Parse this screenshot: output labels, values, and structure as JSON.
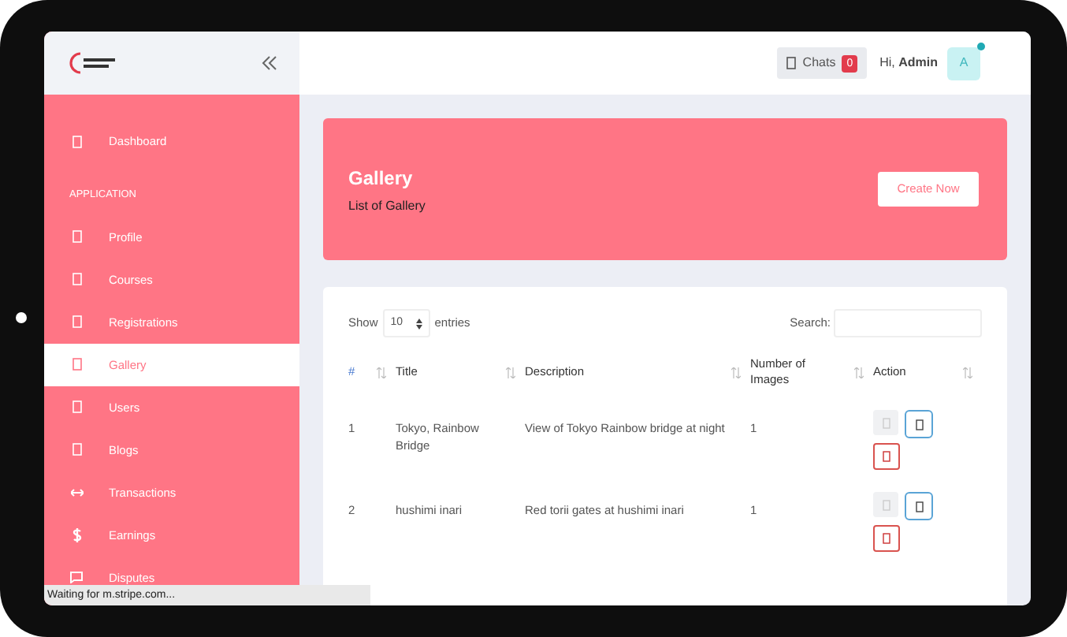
{
  "sidebar": {
    "items": [
      {
        "kind": "item",
        "label": "Dashboard",
        "selected": false
      },
      {
        "kind": "section",
        "label": "APPLICATION"
      },
      {
        "kind": "item",
        "label": "Profile",
        "selected": false
      },
      {
        "kind": "item",
        "label": "Courses",
        "selected": false
      },
      {
        "kind": "item",
        "label": "Registrations",
        "selected": false
      },
      {
        "kind": "item",
        "label": "Gallery",
        "selected": true
      },
      {
        "kind": "item",
        "label": "Users",
        "selected": false
      },
      {
        "kind": "item",
        "label": "Blogs",
        "selected": false
      },
      {
        "kind": "item",
        "label": "Transactions",
        "selected": false
      },
      {
        "kind": "item",
        "label": "Earnings",
        "selected": false
      },
      {
        "kind": "item",
        "label": "Disputes",
        "selected": false
      }
    ]
  },
  "header": {
    "chats": {
      "label": "Chats",
      "badge": "0"
    },
    "greeting": "Hi, **Admin**",
    "avatar": "A"
  },
  "banner": {
    "title": "Gallery",
    "subtitle": "List of Gallery",
    "button": "Create Now"
  },
  "table": {
    "show_label": "Show",
    "page_size": "10",
    "entries_label": "entries",
    "search_label": "Search:",
    "columns": [
      "#",
      "Title",
      "Description",
      "Number of Images",
      "Action"
    ],
    "rows": [
      {
        "cells": [
          "1",
          "Tokyo, Rainbow Bridge",
          "View of Tokyo Rainbow bridge at night",
          "1"
        ]
      },
      {
        "cells": [
          "2",
          "hushimi inari",
          "Red torii gates at hushimi inari",
          "1"
        ]
      }
    ]
  },
  "status_bar": "Waiting for m.stripe.com..."
}
